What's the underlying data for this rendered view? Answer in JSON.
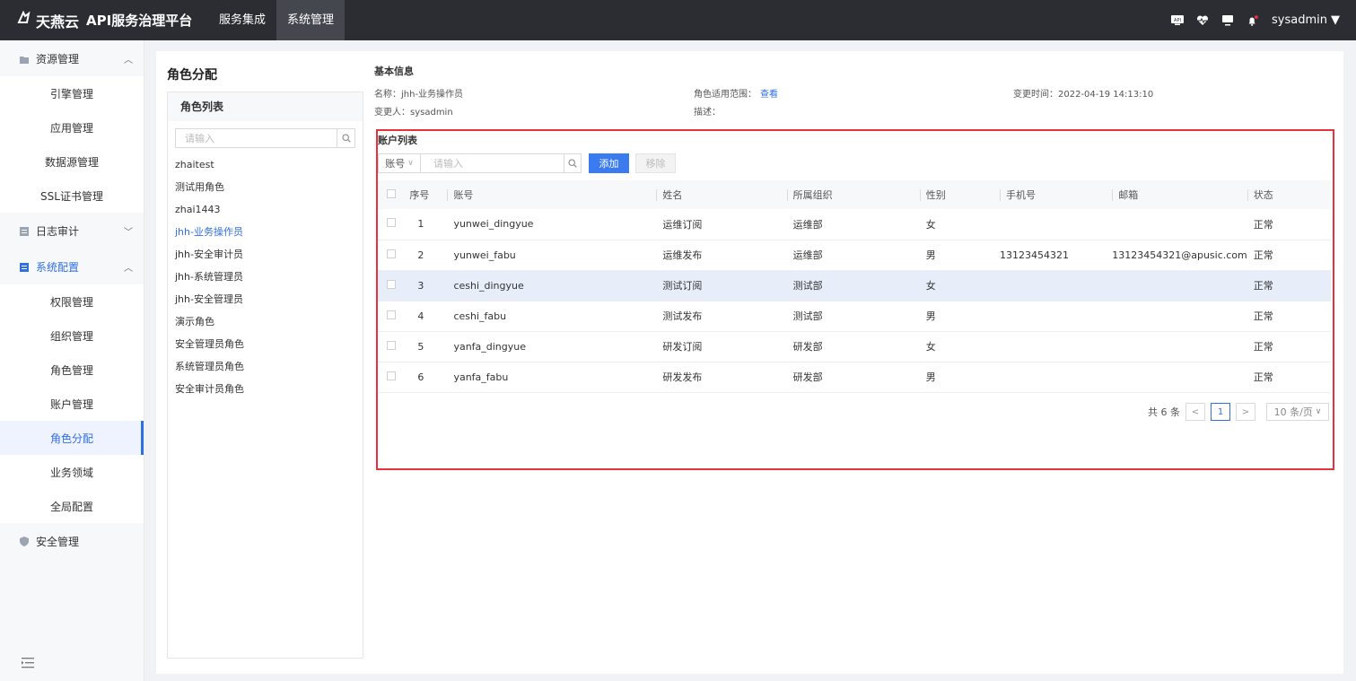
{
  "header": {
    "logo_mark": "ฉ",
    "brand": "天燕云",
    "platform": "API服务治理平台",
    "nav": [
      {
        "label": "服务集成"
      },
      {
        "label": "系统管理"
      }
    ],
    "user": "sysadmin",
    "icons": [
      "api-icon",
      "heartbeat-icon",
      "monitor-icon",
      "bell-icon"
    ]
  },
  "sidebar": {
    "groups": [
      {
        "label": "资源管理",
        "chevron": "^",
        "items": [
          "引擎管理",
          "应用管理",
          "数据源管理",
          "SSL证书管理"
        ]
      },
      {
        "label": "日志审计",
        "chevron": "v"
      },
      {
        "label": "系统配置",
        "chevron": "^",
        "items": [
          "权限管理",
          "组织管理",
          "角色管理",
          "账户管理",
          "角色分配",
          "业务领域",
          "全局配置"
        ]
      },
      {
        "label": "安全管理"
      }
    ],
    "active_item": "角色分配",
    "collapse_icon": "☰"
  },
  "page": {
    "title": "角色分配"
  },
  "role_panel": {
    "header": "角色列表",
    "search_placeholder": "请输入",
    "roles": [
      "zhaitest",
      "测试用角色",
      "zhai1443",
      "jhh-业务操作员",
      "jhh-安全审计员",
      "jhh-系统管理员",
      "jhh-安全管理员",
      "演示角色",
      "安全管理员角色",
      "系统管理员角色",
      "安全审计员角色"
    ],
    "active_role": "jhh-业务操作员"
  },
  "basic_info": {
    "title": "基本信息",
    "name": "名称：jhh-业务操作员",
    "scope_label": "角色适用范围：",
    "scope_link": "查看",
    "changed_time": "变更时间：2022-04-19 14:13:10",
    "changer": "变更人：sysadmin",
    "description": "描述："
  },
  "accounts": {
    "title": "账户列表",
    "select_value": "账号",
    "search_placeholder": "请输入",
    "add_label": "添加",
    "remove_label": "移除",
    "columns": [
      "序号",
      "账号",
      "姓名",
      "所属组织",
      "性别",
      "手机号",
      "邮箱",
      "状态"
    ],
    "rows": [
      {
        "no": "1",
        "account": "yunwei_dingyue",
        "name": "运维订阅",
        "org": "运维部",
        "gender": "女",
        "phone": "",
        "email": "",
        "status": "正常"
      },
      {
        "no": "2",
        "account": "yunwei_fabu",
        "name": "运维发布",
        "org": "运维部",
        "gender": "男",
        "phone": "13123454321",
        "email": "13123454321@apusic.com",
        "status": "正常"
      },
      {
        "no": "3",
        "account": "ceshi_dingyue",
        "name": "测试订阅",
        "org": "测试部",
        "gender": "女",
        "phone": "",
        "email": "",
        "status": "正常"
      },
      {
        "no": "4",
        "account": "ceshi_fabu",
        "name": "测试发布",
        "org": "测试部",
        "gender": "男",
        "phone": "",
        "email": "",
        "status": "正常"
      },
      {
        "no": "5",
        "account": "yanfa_dingyue",
        "name": "研发订阅",
        "org": "研发部",
        "gender": "女",
        "phone": "",
        "email": "",
        "status": "正常"
      },
      {
        "no": "6",
        "account": "yanfa_fabu",
        "name": "研发发布",
        "org": "研发部",
        "gender": "男",
        "phone": "",
        "email": "",
        "status": "正常"
      }
    ],
    "highlighted_row": 3,
    "pager": {
      "total": "共 6 条",
      "current": "1",
      "page_size": "10 条/页"
    }
  }
}
